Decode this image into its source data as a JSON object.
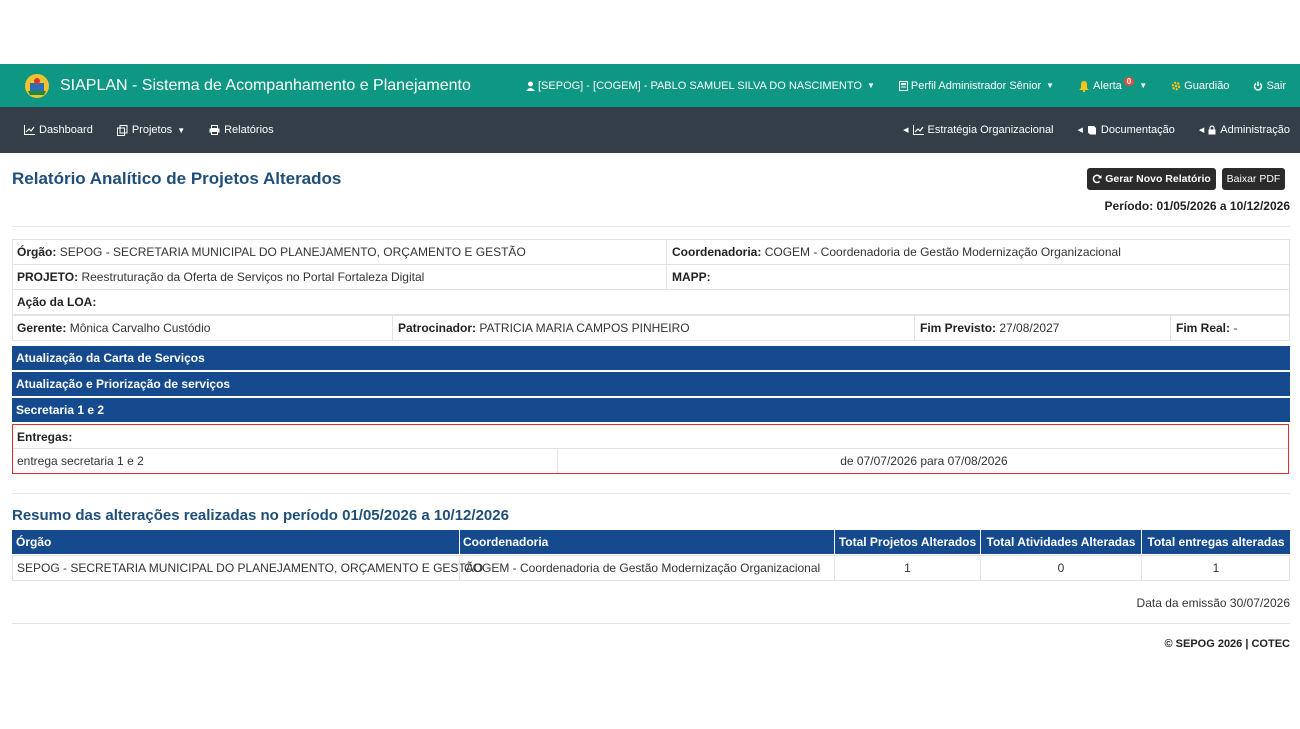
{
  "topbar": {
    "title": "SIAPLAN - Sistema de Acompanhamento e Planejamento",
    "user": "[SEPOG] - [COGEM] - PABLO SAMUEL SILVA DO NASCIMENTO",
    "profile": "Perfil Administrador Sênior",
    "alert_label": "Alerta",
    "alert_count": "0",
    "guardian": "Guardião",
    "logout": "Sair"
  },
  "nav": {
    "left": [
      "Dashboard",
      "Projetos",
      "Relatórios"
    ],
    "right": [
      "Estratégia Organizacional",
      "Documentação",
      "Administração"
    ]
  },
  "header": {
    "title": "Relatório Analítico de Projetos Alterados",
    "btn_generate": "Gerar Novo Relatório",
    "btn_pdf": "Baixar PDF",
    "periodo": "Período: 01/05/2026 a 10/12/2026"
  },
  "project": {
    "orgao_label": "Órgão:",
    "orgao": "SEPOG - SECRETARIA MUNICIPAL DO PLANEJAMENTO, ORÇAMENTO E GESTÃO",
    "coord_label": "Coordenadoria:",
    "coord": "COGEM - Coordenadoria de Gestão Modernização Organizacional",
    "projeto_label": "PROJETO:",
    "projeto": "Reestruturação da Oferta de Serviços no Portal Fortaleza Digital",
    "mapp_label": "MAPP:",
    "acao_label": "Ação da LOA:",
    "gerente_label": "Gerente:",
    "gerente": "Mônica Carvalho Custódio",
    "patrocinador_label": "Patrocinador:",
    "patrocinador": "PATRICIA MARIA CAMPOS PINHEIRO",
    "fim_previsto_label": "Fim Previsto:",
    "fim_previsto": "27/08/2027",
    "fim_real_label": "Fim Real:",
    "fim_real": "-"
  },
  "bars": [
    "Atualização da Carta de Serviços",
    "Atualização e Priorização de serviços",
    "Secretaria 1 e 2"
  ],
  "entregas": {
    "label": "Entregas:",
    "name": "entrega secretaria 1 e 2",
    "change": "de 07/07/2026 para 07/08/2026"
  },
  "summary": {
    "title": "Resumo das alterações realizadas no período 01/05/2026 a 10/12/2026",
    "headers": [
      "Órgão",
      "Coordenadoria",
      "Total Projetos Alterados",
      "Total Atividades Alteradas",
      "Total entregas alteradas"
    ],
    "row": [
      "SEPOG - SECRETARIA MUNICIPAL DO PLANEJAMENTO, ORÇAMENTO E GESTÃO",
      "COGEM - Coordenadoria de Gestão Modernização Organizacional",
      "1",
      "0",
      "1"
    ]
  },
  "emissao": "Data da emissão 30/07/2026",
  "footer": "© SEPOG 2026 | COTEC",
  "colors": {
    "topbar": "#0e9782",
    "navbar": "#333e48",
    "blue": "#154b8e",
    "title": "#1f4e79",
    "alert_red": "#d92f2f"
  }
}
